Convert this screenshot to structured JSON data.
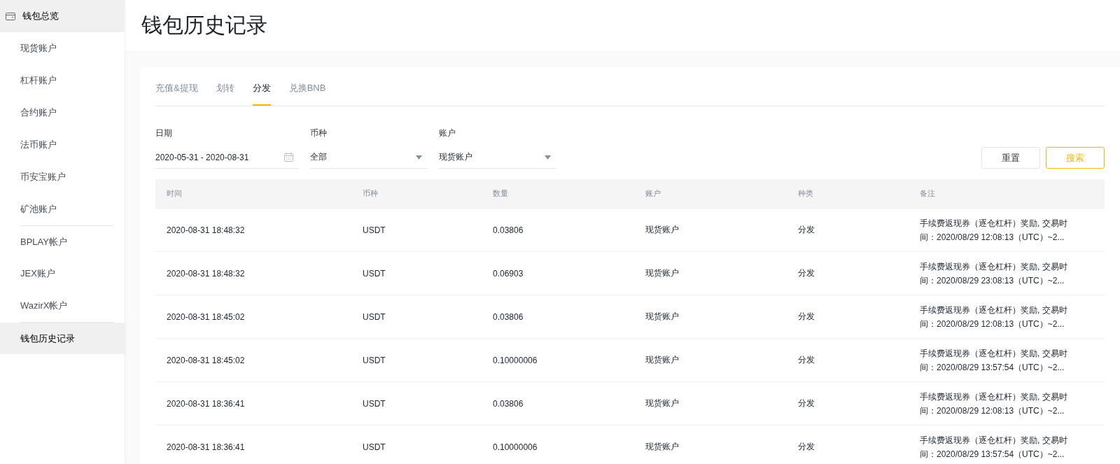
{
  "sidebar": {
    "items": [
      {
        "label": "钱包总览",
        "kind": "header",
        "selected": true
      },
      {
        "label": "现货账户",
        "kind": "item",
        "selected": false
      },
      {
        "label": "杠杆账户",
        "kind": "item",
        "selected": false
      },
      {
        "label": "合约账户",
        "kind": "item",
        "selected": false
      },
      {
        "label": "法币账户",
        "kind": "item",
        "selected": false
      },
      {
        "label": "币安宝账户",
        "kind": "item",
        "selected": false
      },
      {
        "label": "矿池账户",
        "kind": "item",
        "selected": false
      },
      {
        "label": "BPLAY帐户",
        "kind": "divided",
        "selected": false
      },
      {
        "label": "JEX账户",
        "kind": "item",
        "selected": false
      },
      {
        "label": "WazirX帐户",
        "kind": "item",
        "selected": false
      },
      {
        "label": "钱包历史记录",
        "kind": "divided",
        "selected": true
      }
    ]
  },
  "page": {
    "title": "钱包历史记录"
  },
  "tabs": [
    {
      "label": "充值&提现",
      "selected": false
    },
    {
      "label": "划转",
      "selected": false
    },
    {
      "label": "分发",
      "selected": true
    },
    {
      "label": "兑换BNB",
      "selected": false
    }
  ],
  "filters": [
    {
      "label": "日期",
      "value": "2020-05-31 - 2020-08-31",
      "kind": "date"
    },
    {
      "label": "币种",
      "value": "全部",
      "kind": "select"
    },
    {
      "label": "账户",
      "value": "现货账户",
      "kind": "select"
    }
  ],
  "buttons": [
    {
      "label": "重置",
      "kind": "default"
    },
    {
      "label": "搜索",
      "kind": "primary"
    }
  ],
  "table": {
    "columns": [
      "时间",
      "币种",
      "数量",
      "账户",
      "种类",
      "备注"
    ],
    "rows": [
      {
        "cells": [
          "2020-08-31 18:48:32",
          "USDT",
          "0.03806",
          "现货账户",
          "分发"
        ],
        "note": [
          "手续费返现券（逐仓杠杆）奖励, 交易时",
          "间：2020/08/29 12:08:13（UTC）~2..."
        ]
      },
      {
        "cells": [
          "2020-08-31 18:48:32",
          "USDT",
          "0.06903",
          "现货账户",
          "分发"
        ],
        "note": [
          "手续费返现券（逐仓杠杆）奖励, 交易时",
          "间：2020/08/29 23:08:13（UTC）~2..."
        ]
      },
      {
        "cells": [
          "2020-08-31 18:45:02",
          "USDT",
          "0.03806",
          "现货账户",
          "分发"
        ],
        "note": [
          "手续费返现券（逐仓杠杆）奖励, 交易时",
          "间：2020/08/29 12:08:13（UTC）~2..."
        ]
      },
      {
        "cells": [
          "2020-08-31 18:45:02",
          "USDT",
          "0.10000006",
          "现货账户",
          "分发"
        ],
        "note": [
          "手续费返现券（逐仓杠杆）奖励, 交易时",
          "间：2020/08/29 13:57:54（UTC）~2..."
        ]
      },
      {
        "cells": [
          "2020-08-31 18:36:41",
          "USDT",
          "0.03806",
          "现货账户",
          "分发"
        ],
        "note": [
          "手续费返现券（逐仓杠杆）奖励, 交易时",
          "间：2020/08/29 12:08:13（UTC）~2..."
        ]
      },
      {
        "cells": [
          "2020-08-31 18:36:41",
          "USDT",
          "0.10000006",
          "现货账户",
          "分发"
        ],
        "note": [
          "手续费返现券（逐仓杠杆）奖励, 交易时",
          "间：2020/08/29 13:57:54（UTC）~2..."
        ]
      }
    ]
  }
}
